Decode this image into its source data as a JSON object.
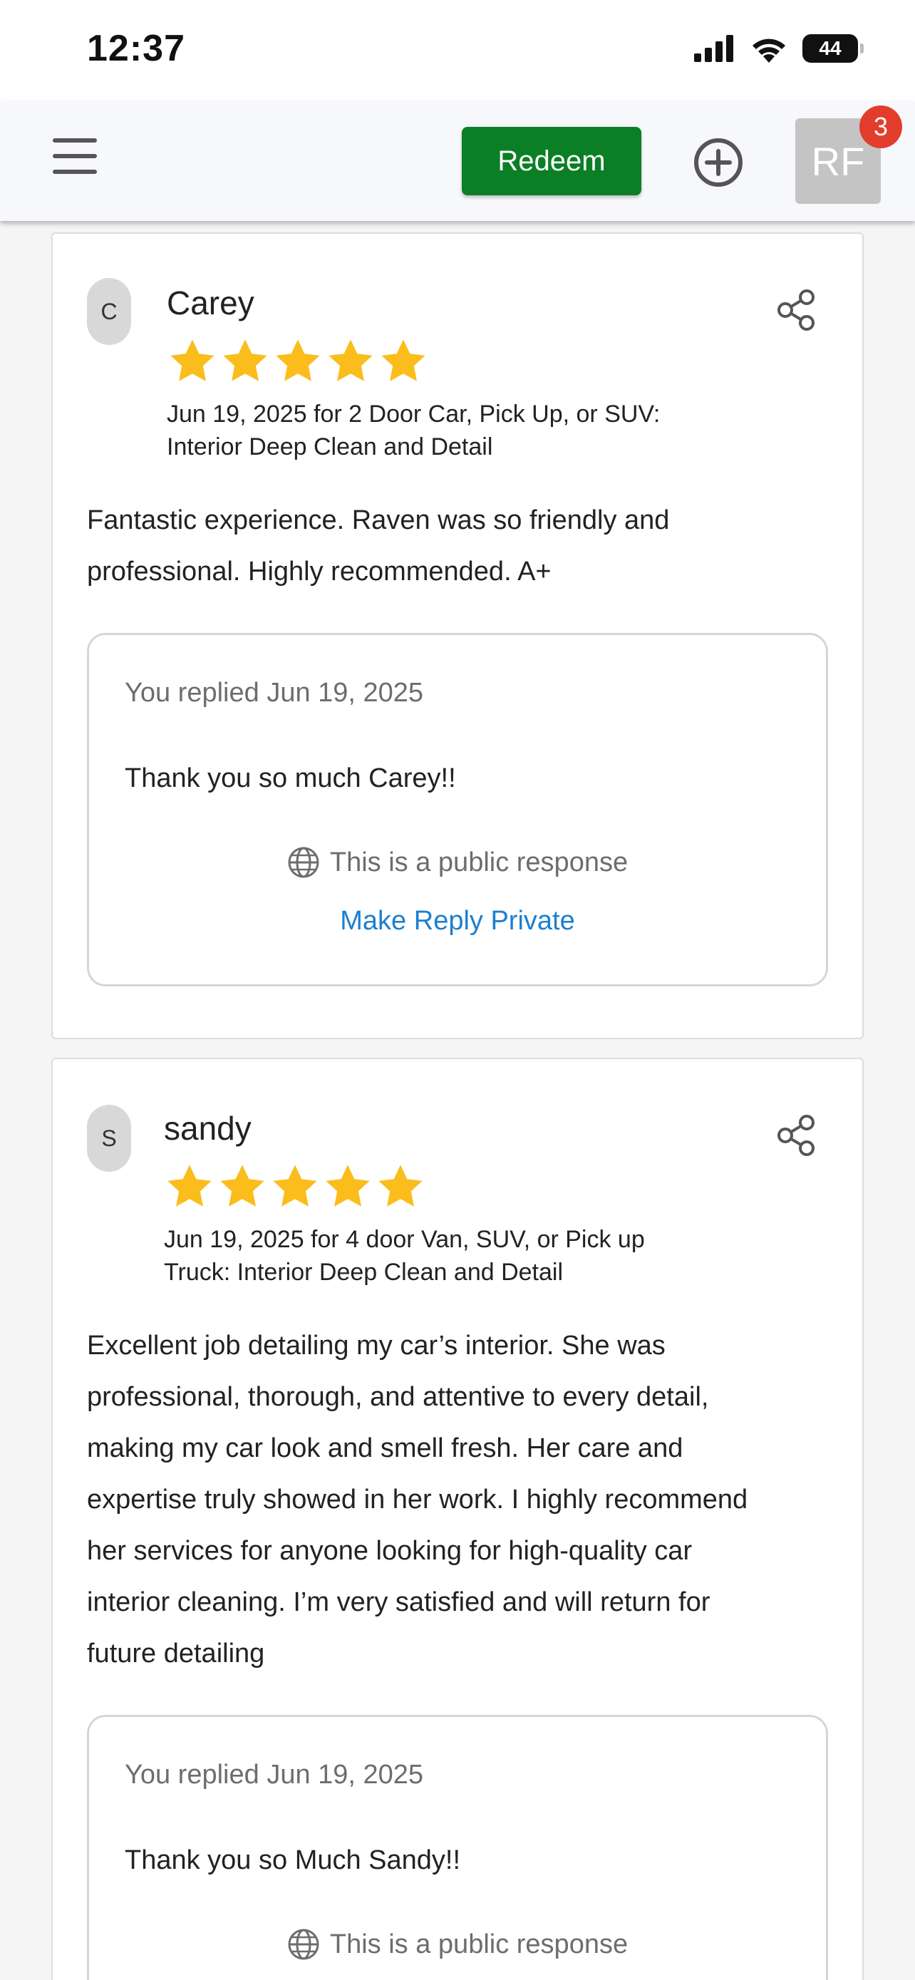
{
  "status_bar": {
    "time": "12:37",
    "battery": "44"
  },
  "header": {
    "redeem_label": "Redeem",
    "avatar_initials": "RF",
    "notification_count": "3"
  },
  "reviews": [
    {
      "initial": "C",
      "name": "Carey",
      "rating": 5,
      "meta_line1": "Jun 19, 2025 for 2 Door Car, Pick Up, or SUV:",
      "meta_line2": "Interior Deep Clean and Detail",
      "text_lines": [
        "Fantastic experience. Raven was so friendly and",
        "professional. Highly recommended. A+"
      ],
      "reply": {
        "date": "You replied Jun 19, 2025",
        "text": "Thank you so much Carey!!",
        "visibility": "This is a public response",
        "action": "Make Reply Private"
      }
    },
    {
      "initial": "S",
      "name": "sandy",
      "rating": 5,
      "meta_line1": "Jun 19, 2025 for 4 door Van, SUV, or Pick up",
      "meta_line2": "Truck: Interior Deep Clean and Detail",
      "text_lines": [
        "Excellent job detailing my car’s interior. She was",
        "professional, thorough, and attentive to every detail,",
        "making my car look and smell fresh. Her care and",
        "expertise truly showed in her work. I highly recommend",
        "her services for anyone looking for high-quality car",
        "interior cleaning. I’m very satisfied and will return for",
        "future detailing"
      ],
      "reply": {
        "date": "You replied Jun 19, 2025",
        "text": "Thank you so Much Sandy!!",
        "visibility": "This is a public response"
      }
    }
  ],
  "colors": {
    "star": "#fbbd1c",
    "redeem": "#0a7f25",
    "badge": "#e23c2c",
    "link": "#1c7fd0"
  }
}
